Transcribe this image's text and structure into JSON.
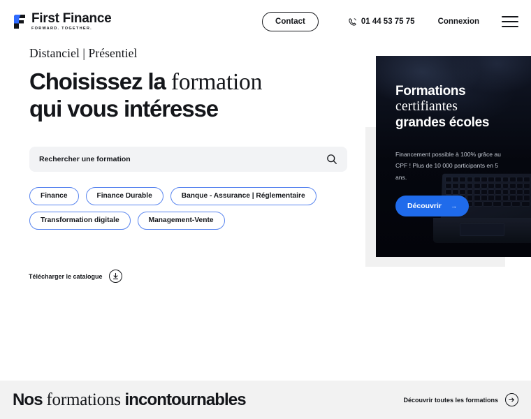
{
  "header": {
    "logo": {
      "name": "First Finance",
      "tagline": "FORWARD. TOGETHER.",
      "mark": "first-finance-logo-mark"
    },
    "contact_label": "Contact",
    "phone": "01 44 53 75 75",
    "phone_icon": "phone-icon",
    "connexion_label": "Connexion",
    "menu_icon": "hamburger-menu-icon"
  },
  "hero": {
    "eyebrow": "Distanciel | Présentiel",
    "title_line1_sans": "Choisissez la ",
    "title_line1_serif": "formation",
    "title_line2": "qui vous intéresse"
  },
  "search": {
    "placeholder": "Rechercher une formation",
    "value": "",
    "icon": "search-icon"
  },
  "filters": {
    "pills": [
      {
        "label": "Finance"
      },
      {
        "label": "Finance Durable"
      },
      {
        "label": "Banque - Assurance | Réglementaire"
      },
      {
        "label": "Transformation digitale"
      },
      {
        "label": "Management-Vente"
      }
    ]
  },
  "catalogue": {
    "label": "Télécharger le catalogue",
    "icon": "download-icon"
  },
  "promo": {
    "title_line1": "Formations",
    "title_line2": "certifiantes",
    "title_line3": "grandes écoles",
    "description": "Financement possible à 100% grâce au CPF ! Plus de 10 000 participants en 5 ans.",
    "button_label": "Découvrir",
    "button_arrow": "→",
    "image": "laptop-keyboard-dark-photo"
  },
  "bottom": {
    "title_sans_1": "Nos ",
    "title_serif": "formations",
    "title_sans_2": " incontournables",
    "link_label": "Découvrir toutes les formations",
    "link_icon": "arrow-right-icon"
  },
  "colors": {
    "accent_blue": "#1f6beb",
    "pill_border": "#5a86ef",
    "ink": "#14161a",
    "search_bg": "#f2f3f5",
    "band_bg": "#f2f2f2",
    "promo_bg": "#05070e"
  }
}
